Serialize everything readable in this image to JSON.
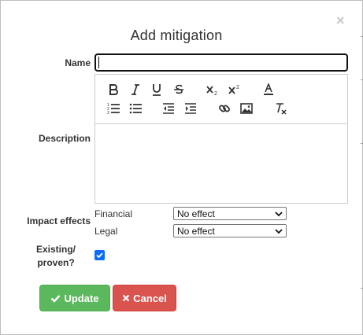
{
  "dialog": {
    "title": "Add mitigation",
    "close_symbol": "×"
  },
  "form": {
    "name_label": "Name",
    "name_value": "",
    "description_label": "Description",
    "description_value": "",
    "impact_label": "Impact effects",
    "impacts": [
      {
        "label": "Financial",
        "selected": "No effect"
      },
      {
        "label": "Legal",
        "selected": "No effect"
      }
    ],
    "existing_label_line1": "Existing/",
    "existing_label_line2": "proven?",
    "existing_checked": true
  },
  "toolbar": {
    "row1": [
      "bold-icon",
      "italic-icon",
      "underline-icon",
      "strikethrough-icon",
      "subscript-icon",
      "superscript-icon",
      "text-color-icon"
    ],
    "row2": [
      "numbered-list-icon",
      "bulleted-list-icon",
      "outdent-icon",
      "indent-icon",
      "link-icon",
      "image-icon",
      "clear-format-icon"
    ]
  },
  "buttons": {
    "update_label": "Update",
    "cancel_label": "Cancel",
    "update_color": "#5cb85c",
    "cancel_color": "#d9534f"
  }
}
